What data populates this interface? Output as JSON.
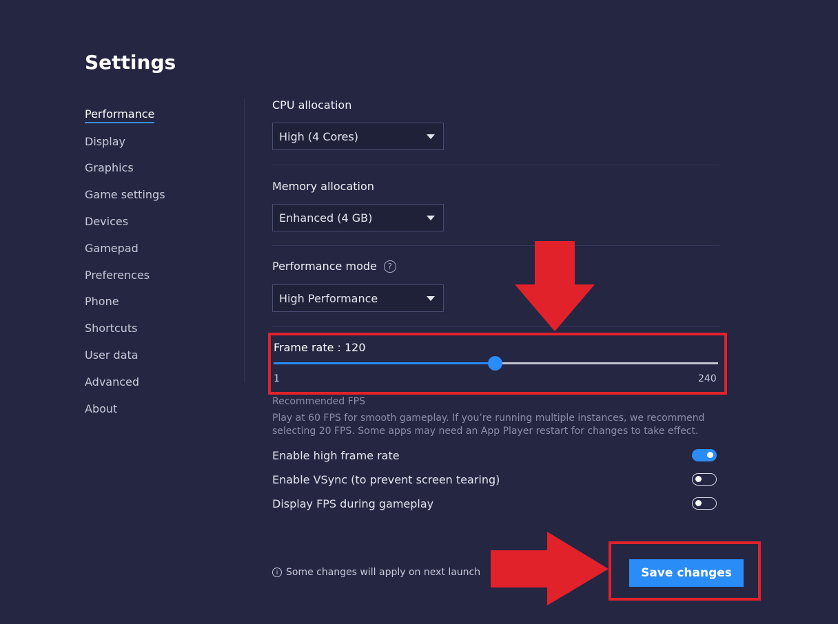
{
  "page": {
    "title": "Settings"
  },
  "sidebar": {
    "items": [
      {
        "label": "Performance",
        "active": true
      },
      {
        "label": "Display"
      },
      {
        "label": "Graphics"
      },
      {
        "label": "Game settings"
      },
      {
        "label": "Devices"
      },
      {
        "label": "Gamepad"
      },
      {
        "label": "Preferences"
      },
      {
        "label": "Phone"
      },
      {
        "label": "Shortcuts"
      },
      {
        "label": "User data"
      },
      {
        "label": "Advanced"
      },
      {
        "label": "About"
      }
    ]
  },
  "cpu": {
    "label": "CPU allocation",
    "value": "High (4 Cores)"
  },
  "memory": {
    "label": "Memory allocation",
    "value": "Enhanced (4 GB)"
  },
  "perf_mode": {
    "label": "Performance mode",
    "value": "High Performance",
    "help_glyph": "?"
  },
  "frame_rate": {
    "label": "Frame rate : 120",
    "value": 120,
    "min": 1,
    "max": 240,
    "min_label": "1",
    "max_label": "240"
  },
  "recommended": {
    "title": "Recommended FPS",
    "description": "Play at 60 FPS for smooth gameplay. If you’re running multiple instances, we recommend selecting 20 FPS. Some apps may need an App Player restart for changes to take effect."
  },
  "toggles": [
    {
      "label": "Enable high frame rate",
      "on": true
    },
    {
      "label": "Enable VSync (to prevent screen tearing)",
      "on": false
    },
    {
      "label": "Display FPS during gameplay",
      "on": false
    }
  ],
  "footer": {
    "note": "Some changes will apply on next launch",
    "info_glyph": "i",
    "save_label": "Save changes"
  },
  "colors": {
    "background": "#242642",
    "accent": "#2a8cf7",
    "annotation_red": "#e2222b"
  }
}
